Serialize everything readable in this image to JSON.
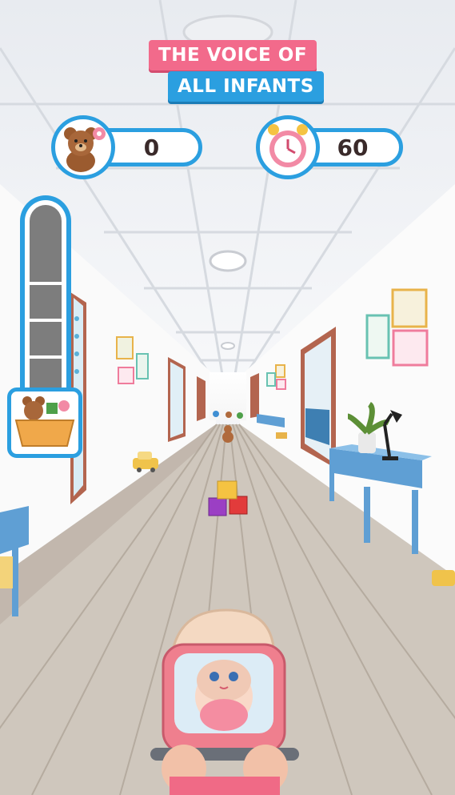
{
  "title": {
    "line1": "THE VOICE OF",
    "line2": "ALL INFANTS"
  },
  "hud": {
    "score": {
      "icon": "teddy-bear-icon",
      "value": "0"
    },
    "timer": {
      "icon": "alarm-clock-icon",
      "value": "60"
    }
  },
  "meter": {
    "icon": "toy-basket-icon",
    "fill_fraction": 0,
    "segments": 4
  },
  "scene": {
    "obstacles": [
      "toy-blocks",
      "toy-car",
      "teddy-bear",
      "potted-plant"
    ],
    "player": "baby-in-pink-stroller"
  },
  "colors": {
    "accent_blue": "#2b9fe0",
    "accent_pink": "#f26a8b",
    "floor": "#cfc7bd",
    "wall": "#ffffff"
  }
}
